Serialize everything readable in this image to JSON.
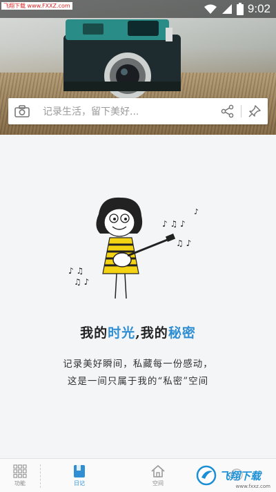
{
  "status_bar": {
    "watermark": "飞翔下载 www.FXXZ.com",
    "time": "9:02"
  },
  "search": {
    "placeholder": "记录生活，留下美好..."
  },
  "main": {
    "tagline_part1": "我的",
    "tagline_hl1": "时光",
    "tagline_part2": ",我的",
    "tagline_hl2": "秘密",
    "desc_line1": "记录美好瞬间，私藏每一份感动，",
    "desc_line2": "这是一间只属于我的“私密”空间"
  },
  "nav": {
    "items": [
      {
        "label": "功能",
        "icon": "grid-icon"
      },
      {
        "label": "日记",
        "icon": "diary-icon"
      },
      {
        "label": "空间",
        "icon": "home-icon"
      },
      {
        "label": "",
        "icon": "more-icon"
      }
    ]
  },
  "brand": {
    "name": "飞翔下载",
    "url": "www.fxxz.com"
  },
  "colors": {
    "accent": "#2f8fd2"
  }
}
